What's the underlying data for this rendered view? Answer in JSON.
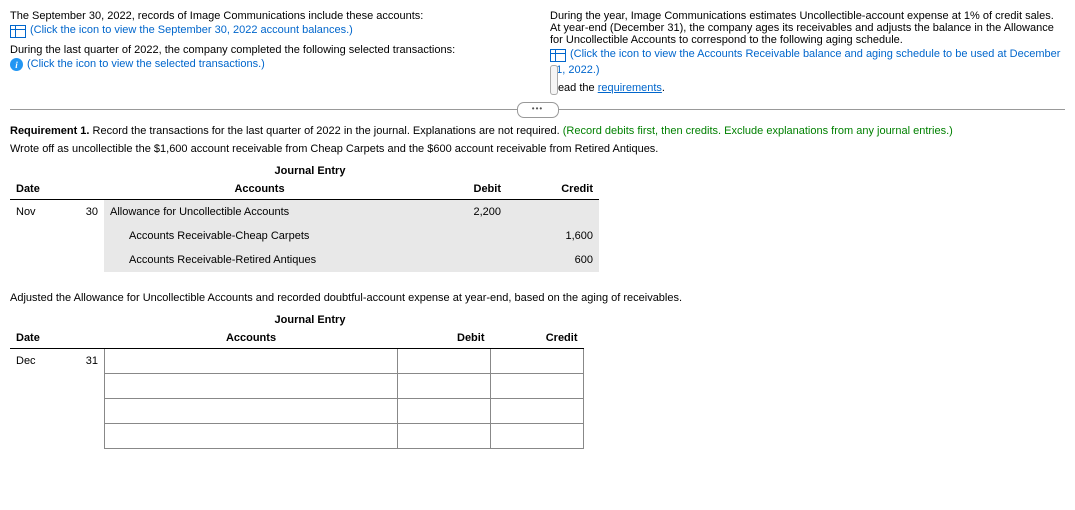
{
  "top": {
    "left": {
      "line1": "The September 30, 2022, records of Image Communications include these accounts:",
      "link1": "(Click the icon to view the September 30, 2022 account balances.)",
      "line2": "During the last quarter of 2022, the company completed the following selected transactions:",
      "link2": "(Click the icon to view the selected transactions.)"
    },
    "right": {
      "para": "During the year, Image Communications estimates Uncollectible-account expense at 1% of credit sales. At year-end (December 31), the company ages its receivables and adjusts the balance in the Allowance for Uncollectible Accounts to correspond to the following aging schedule.",
      "link1a": "(Click the icon to view the Accounts Receivable balance and aging schedule to be used at December",
      "link1b": "31, 2022.)",
      "read": "Read the ",
      "reqlink": "requirements"
    }
  },
  "req": {
    "label": "Requirement 1.",
    "text": " Record the transactions for the last quarter of 2022 in the journal. Explanations are not required. ",
    "note": "(Record debits first, then credits. Exclude explanations from any journal entries.)"
  },
  "entry1": {
    "desc": "Wrote off as uncollectible the $1,600 account receivable from Cheap Carpets and the $600 account receivable from Retired Antiques.",
    "title": "Journal Entry",
    "headers": {
      "date": "Date",
      "accounts": "Accounts",
      "debit": "Debit",
      "credit": "Credit"
    },
    "month": "Nov",
    "day": "30",
    "r1": {
      "acct": "Allowance for Uncollectible Accounts",
      "debit": "2,200",
      "credit": ""
    },
    "r2": {
      "acct": "Accounts Receivable-Cheap Carpets",
      "debit": "",
      "credit": "1,600"
    },
    "r3": {
      "acct": "Accounts Receivable-Retired Antiques",
      "debit": "",
      "credit": "600"
    }
  },
  "entry2": {
    "desc": "Adjusted the Allowance for Uncollectible Accounts and recorded doubtful-account expense at year-end, based on the aging of receivables.",
    "title": "Journal Entry",
    "headers": {
      "date": "Date",
      "accounts": "Accounts",
      "debit": "Debit",
      "credit": "Credit"
    },
    "month": "Dec",
    "day": "31"
  }
}
